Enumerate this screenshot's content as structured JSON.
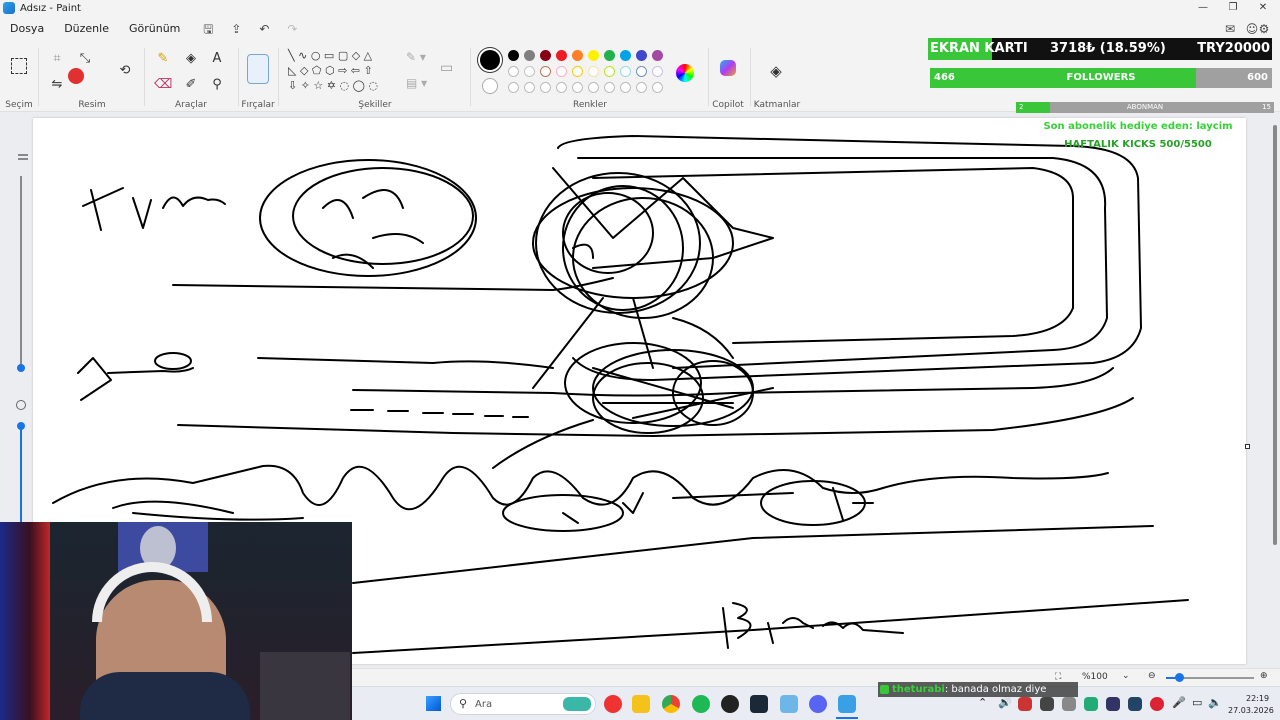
{
  "window": {
    "title": "Adsız - Paint",
    "controls": [
      "—",
      "❐",
      "✕"
    ]
  },
  "menu": {
    "items": [
      "Dosya",
      "Düzenle",
      "Görünüm"
    ]
  },
  "ribbon": {
    "groups": {
      "selection": "Seçim",
      "image": "Resim",
      "tools": "Araçlar",
      "brushes": "Fırçalar",
      "shapes": "Şekiller",
      "colors": "Renkler",
      "copilot": "Copilot",
      "layers": "Katmanlar"
    },
    "colors_row1": [
      "#000000",
      "#7f7f7f",
      "#880015",
      "#ed1c24",
      "#ff7f27",
      "#fff200",
      "#22b14c",
      "#00a2e8",
      "#3f48cc",
      "#a349a4"
    ],
    "colors_row2": [
      "#ffffff",
      "#c3c3c3",
      "#b97a57",
      "#ffaec9",
      "#ffc90e",
      "#efe4b0",
      "#b5e61d",
      "#99d9ea",
      "#7092be",
      "#c8bfe7"
    ]
  },
  "stream_overlay": {
    "gpu_label": "EKRAN KARTI",
    "gpu_amount": "3718₺ (18.59%)",
    "gpu_goal": "TRY20000",
    "gpu_progress": 0.1859,
    "followers_current": "466",
    "followers_label": "FOLLOWERS",
    "followers_goal": "600",
    "followers_progress": 0.7767,
    "sub_current": "2",
    "sub_label": "ABONMAN",
    "sub_goal": "15",
    "sub_progress": 0.1333,
    "last_gift": "Son abonelik hediye eden: laycim",
    "weekly_kicks": "HAFTALIK KICKS 500/5500"
  },
  "statusbar": {
    "zoom": "%100"
  },
  "chat": {
    "user": "theturabi",
    "message": ": banada olmaz diye"
  },
  "taskbar": {
    "search_placeholder": "Ara",
    "time": "22:19",
    "date": "27.03.2026"
  }
}
